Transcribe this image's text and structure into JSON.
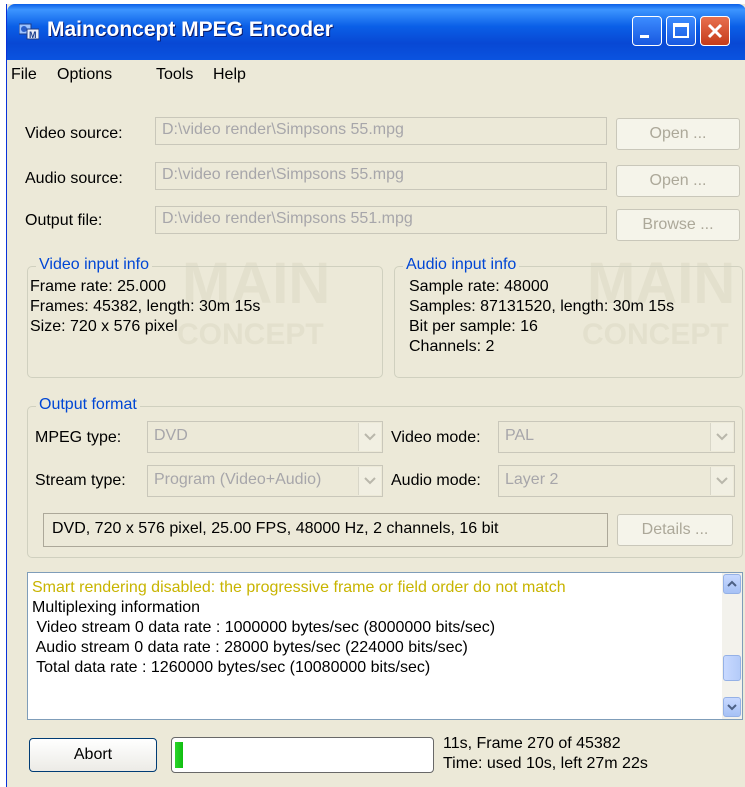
{
  "window": {
    "title": "Mainconcept MPEG Encoder",
    "icon": "mainconcept-app-icon",
    "controls": {
      "minimize": "minimize-icon",
      "maximize": "maximize-icon",
      "close": "close-icon"
    }
  },
  "menu": [
    "File",
    "Options",
    "Tools",
    "Help"
  ],
  "sources": {
    "video_label": "Video source:",
    "video_value": "D:\\video render\\Simpsons 55.mpg",
    "audio_label": "Audio source:",
    "audio_value": "D:\\video render\\Simpsons 55.mpg",
    "output_label": "Output file:",
    "output_value": "D:\\video render\\Simpsons 551.mpg",
    "open_label": "Open ...",
    "browse_label": "Browse ..."
  },
  "video_info": {
    "title": "Video input info",
    "lines": [
      "Frame rate: 25.000",
      "Frames: 45382, length: 30m 15s",
      "Size: 720 x 576 pixel"
    ]
  },
  "audio_info": {
    "title": "Audio input info",
    "lines": [
      "Sample rate: 48000",
      "Samples: 87131520, length: 30m 15s",
      "Bit per sample: 16",
      "Channels: 2"
    ]
  },
  "output_format": {
    "title": "Output format",
    "mpeg_type_label": "MPEG type:",
    "mpeg_type_value": "DVD",
    "video_mode_label": "Video mode:",
    "video_mode_value": "PAL",
    "stream_type_label": "Stream type:",
    "stream_type_value": "Program (Video+Audio)",
    "audio_mode_label": "Audio mode:",
    "audio_mode_value": "Layer 2",
    "summary": "DVD, 720 x 576 pixel, 25.00 FPS, 48000 Hz, 2 channels, 16 bit",
    "details_label": "Details ..."
  },
  "log": {
    "warning": "Smart rendering disabled: the progressive frame or field order do not match",
    "warning_color": "#c8b400",
    "lines": [
      "Multiplexing information",
      " Video stream 0 data rate : 1000000 bytes/sec (8000000 bits/sec)",
      " Audio stream 0 data rate : 28000 bytes/sec (224000 bits/sec)",
      " Total data rate : 1260000 bytes/sec (10080000 bits/sec)"
    ]
  },
  "footer": {
    "abort_label": "Abort",
    "progress_fraction": 0.006,
    "status_frame": "11s, Frame 270 of 45382",
    "status_time": "Time: used 10s, left 27m 22s"
  },
  "watermark": {
    "text_main": "MAIN",
    "text_concept": "CONCEPT"
  },
  "colors": {
    "titlebar": "#0a53e0",
    "dialog_bg": "#ece9d8",
    "group_title": "#0046d5",
    "progress_green": "#16c216",
    "close_button": "#c53c1a"
  }
}
